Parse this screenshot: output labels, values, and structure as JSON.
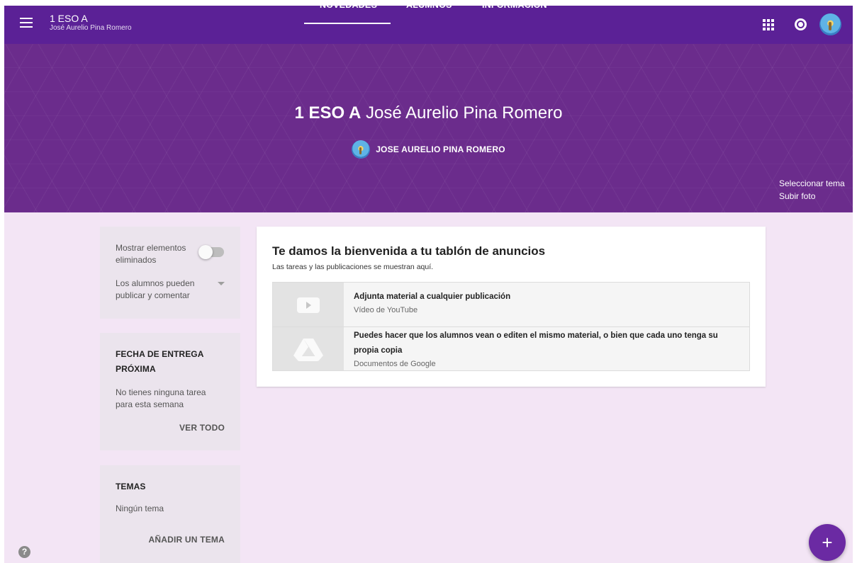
{
  "topbar": {
    "class_name": "1 ESO A",
    "teacher_name": "José Aurelio Pina Romero",
    "tabs": [
      {
        "label": "NOVEDADES",
        "active": true
      },
      {
        "label": "ALUMNOS",
        "active": false
      },
      {
        "label": "INFORMACIÓN",
        "active": false
      }
    ],
    "icons": [
      "menu-icon",
      "apps-icon",
      "notifications-icon",
      "account-avatar"
    ],
    "color": "#5b2196"
  },
  "banner": {
    "title_bold": "1 ESO A",
    "title_rest": " José Aurelio Pina Romero",
    "owner": "JOSE AURELIO PINA ROMERO",
    "select_theme": "Seleccionar tema",
    "upload_photo": "Subir foto",
    "color": "#6b2c8c"
  },
  "sidebar": {
    "show_deleted_label": "Mostrar elementos eliminados",
    "show_deleted_on": false,
    "permissions_value": "Los alumnos pueden publicar y comentar",
    "due": {
      "heading": "FECHA DE ENTREGA PRÓXIMA",
      "text": "No tienes ninguna tarea para esta semana",
      "link": "VER TODO"
    },
    "topics": {
      "heading": "TEMAS",
      "text": "Ningún tema",
      "link": "AÑADIR UN TEMA"
    }
  },
  "board": {
    "title": "Te damos la bienvenida a tu tablón de anuncios",
    "subtitle": "Las tareas y las publicaciones se muestran aquí.",
    "attachments": [
      {
        "name": "Adjunta material a cualquier publicación",
        "type": "Vídeo de YouTube",
        "icon": "youtube-icon"
      },
      {
        "name": "Puedes hacer que los alumnos vean o editen el mismo material, o bien que cada uno tenga su propia copia",
        "type": "Documentos de Google",
        "icon": "drive-icon"
      }
    ]
  },
  "fab": {
    "label": "+",
    "color": "#6b2aa3"
  },
  "help": {
    "label": "?"
  },
  "content_bg": "#f3e5f5"
}
